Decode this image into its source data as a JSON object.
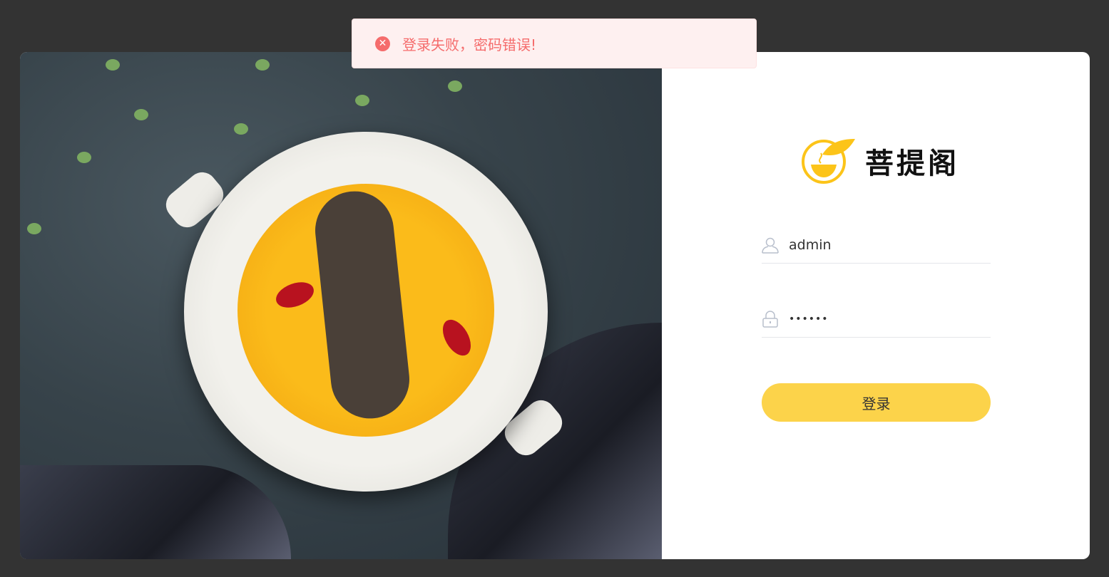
{
  "toast": {
    "icon": "error-circle-icon",
    "message": "登录失败，密码错误!"
  },
  "brand": {
    "name": "菩提阁",
    "accent": "#fcc419"
  },
  "login": {
    "username": "admin",
    "password_masked": "••••••",
    "submit_label": "登录"
  }
}
